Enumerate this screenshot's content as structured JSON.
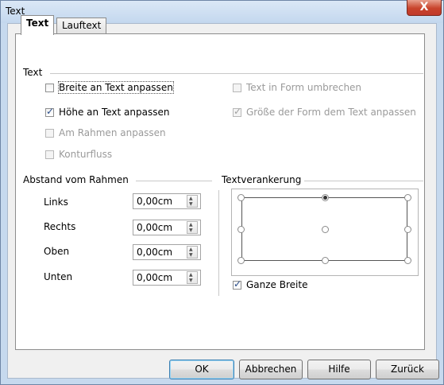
{
  "window": {
    "title": "Text",
    "close_label": "X"
  },
  "tabs": [
    {
      "label": "Text",
      "active": true
    },
    {
      "label": "Lauftext",
      "active": false
    }
  ],
  "text_section": {
    "title": "Text",
    "options": [
      {
        "label": "Breite an Text anpassen",
        "checked": false,
        "enabled": true
      },
      {
        "label": "Höhe an Text anpassen",
        "checked": true,
        "enabled": true
      },
      {
        "label": "Am Rahmen anpassen",
        "checked": false,
        "enabled": false
      },
      {
        "label": "Konturfluss",
        "checked": false,
        "enabled": false
      },
      {
        "label": "Text in Form umbrechen",
        "checked": false,
        "enabled": false
      },
      {
        "label": "Größe der Form dem Text anpassen",
        "checked": true,
        "enabled": false
      }
    ]
  },
  "spacing_section": {
    "title": "Abstand vom Rahmen",
    "fields": [
      {
        "label": "Links",
        "value": "0,00cm"
      },
      {
        "label": "Rechts",
        "value": "0,00cm"
      },
      {
        "label": "Oben",
        "value": "0,00cm"
      },
      {
        "label": "Unten",
        "value": "0,00cm"
      }
    ]
  },
  "anchor_section": {
    "title": "Textverankerung",
    "selected": "top-center",
    "full_width": {
      "label": "Ganze Breite",
      "checked": true
    }
  },
  "buttons": {
    "ok": "OK",
    "cancel": "Abbrechen",
    "help": "Hilfe",
    "reset": "Zurück"
  }
}
